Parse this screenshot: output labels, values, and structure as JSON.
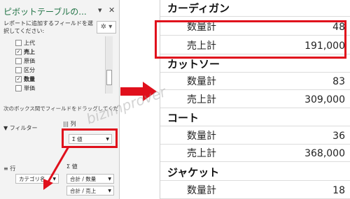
{
  "pane": {
    "title": "ピボットテーブルの...",
    "pin_glyph": "▾",
    "close_glyph": "✕",
    "description": "レポートに追加するフィールドを選択してください:",
    "gear_glyph": "✲ ▾",
    "fields": [
      {
        "label": "上代",
        "checked": false
      },
      {
        "label": "売上",
        "checked": true
      },
      {
        "label": "原価",
        "checked": false
      },
      {
        "label": "区分",
        "checked": false
      },
      {
        "label": "数量",
        "checked": true
      },
      {
        "label": "単価",
        "checked": false
      }
    ],
    "drag_hint": "次のボックス間でフィールドをドラッグしてくださ",
    "filter_label": "フィルター",
    "columns_label": "列",
    "columns_value": "Σ 値",
    "rows_label": "行",
    "rows_value": "カテゴリ名",
    "values_label": "Σ 値",
    "values_items": [
      "合計 / 数量",
      "合計 / 売上"
    ],
    "filter_glyph": "▼",
    "columns_glyph": "|||",
    "rows_glyph": "≡"
  },
  "sheet": {
    "rows": [
      {
        "type": "cat",
        "label": "カーディガン"
      },
      {
        "type": "item",
        "label": "数量計",
        "value": "48"
      },
      {
        "type": "item",
        "label": "売上計",
        "value": "191,000"
      },
      {
        "type": "cat",
        "label": "カットソー"
      },
      {
        "type": "item",
        "label": "数量計",
        "value": "83"
      },
      {
        "type": "item",
        "label": "売上計",
        "value": "309,000"
      },
      {
        "type": "cat",
        "label": "コート"
      },
      {
        "type": "item",
        "label": "数量計",
        "value": "36"
      },
      {
        "type": "item",
        "label": "売上計",
        "value": "368,000"
      },
      {
        "type": "cat",
        "label": "ジャケット"
      },
      {
        "type": "item",
        "label": "数量計",
        "value": "18"
      }
    ]
  },
  "watermark": "bizimprover",
  "colors": {
    "highlight": "#e0101c",
    "title": "#217346"
  }
}
